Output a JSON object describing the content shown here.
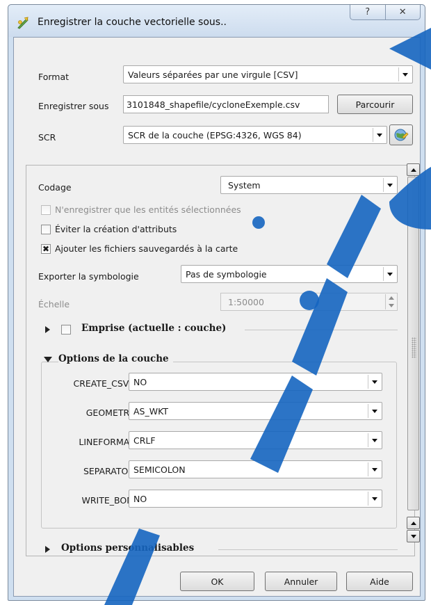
{
  "window": {
    "title": "Enregistrer la couche vectorielle sous..",
    "help_glyph": "?",
    "close_glyph": "✕"
  },
  "form": {
    "format_label": "Format",
    "format_value": "Valeurs séparées par une virgule [CSV]",
    "save_as_label": "Enregistrer sous",
    "save_as_value": "3101848_shapefile/cycloneExemple.csv",
    "browse_label": "Parcourir",
    "crs_label": "SCR",
    "crs_value": "SCR de la couche (EPSG:4326, WGS 84)"
  },
  "panel": {
    "encoding_label": "Codage",
    "encoding_value": "System",
    "only_selected_label": "N'enregistrer que les entités sélectionnées",
    "only_selected_checked": false,
    "skip_attributes_label": "Éviter la création d'attributs",
    "skip_attributes_checked": false,
    "add_to_map_label": "Ajouter les fichiers sauvegardés à la carte",
    "add_to_map_checked": true,
    "check_mark": "✖",
    "symbology_label": "Exporter la symbologie",
    "symbology_value": "Pas de symbologie",
    "scale_label": "Échelle",
    "scale_value": "1:50000",
    "extent_title": "Emprise (actuelle : couche)",
    "layer_options_title": "Options de la couche",
    "layer_options": [
      {
        "key": "CREATE_CSVT",
        "value": "NO"
      },
      {
        "key": "GEOMETRY",
        "value": "AS_WKT"
      },
      {
        "key": "LINEFORMAT",
        "value": "CRLF"
      },
      {
        "key": "SEPARATOR",
        "value": "SEMICOLON"
      },
      {
        "key": "WRITE_BOM",
        "value": "NO"
      }
    ],
    "custom_options_title": "Options personnalisables"
  },
  "footer": {
    "ok_label": "OK",
    "cancel_label": "Annuler",
    "help_label": "Aide"
  },
  "colors": {
    "watermark": "#1565c0",
    "titlebar": "#cddcee",
    "client": "#f0f0f0"
  }
}
